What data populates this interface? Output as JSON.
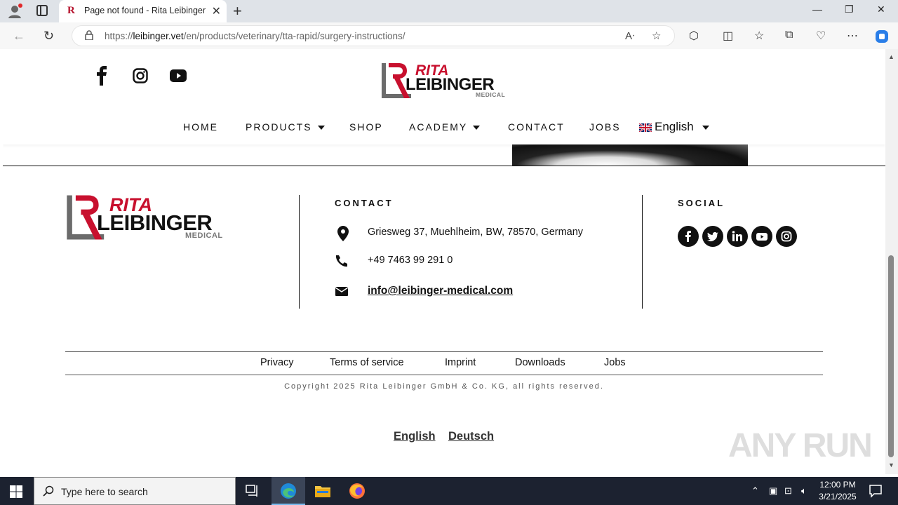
{
  "browser": {
    "tab_title": "Page not found - Rita Leibinger",
    "tab_favicon": "R",
    "url_host": "leibinger.vet",
    "url_prefix": "https://",
    "url_path": "/en/products/veterinary/tta-rapid/surgery-instructions/"
  },
  "header": {
    "logo": {
      "rita": "RITA",
      "leibinger": "LEIBINGER",
      "medical": "MEDICAL"
    },
    "nav": {
      "home": "HOME",
      "products": "PRODUCTS",
      "shop": "SHOP",
      "academy": "ACADEMY",
      "contact": "CONTACT",
      "jobs": "JOBS",
      "language": "English"
    }
  },
  "footer": {
    "logo": {
      "rita": "RITA",
      "leibinger": "LEIBINGER",
      "medical": "MEDICAL"
    },
    "contact": {
      "title": "CONTACT",
      "address": "Griesweg 37, Muehlheim, BW, 78570, Germany",
      "phone": "+49 7463 99 291 0",
      "email": "info@leibinger-medical.com"
    },
    "social": {
      "title": "SOCIAL",
      "icons": [
        "facebook-icon",
        "twitter-icon",
        "linkedin-icon",
        "youtube-icon",
        "instagram-icon"
      ]
    },
    "links": {
      "privacy": "Privacy",
      "terms": "Terms of service",
      "imprint": "Imprint",
      "downloads": "Downloads",
      "jobs": "Jobs"
    },
    "copyright": "Copyright 2025 Rita Leibinger GmbH & Co. KG, all rights reserved.",
    "languages": {
      "english": "English",
      "deutsch": "Deutsch"
    }
  },
  "watermark": "ANY RUN",
  "taskbar": {
    "search_placeholder": "Type here to search",
    "time": "12:00 PM",
    "date": "3/21/2025"
  },
  "colors": {
    "brand_red": "#c8102e",
    "text": "#111111",
    "taskbar": "#1c2230"
  }
}
